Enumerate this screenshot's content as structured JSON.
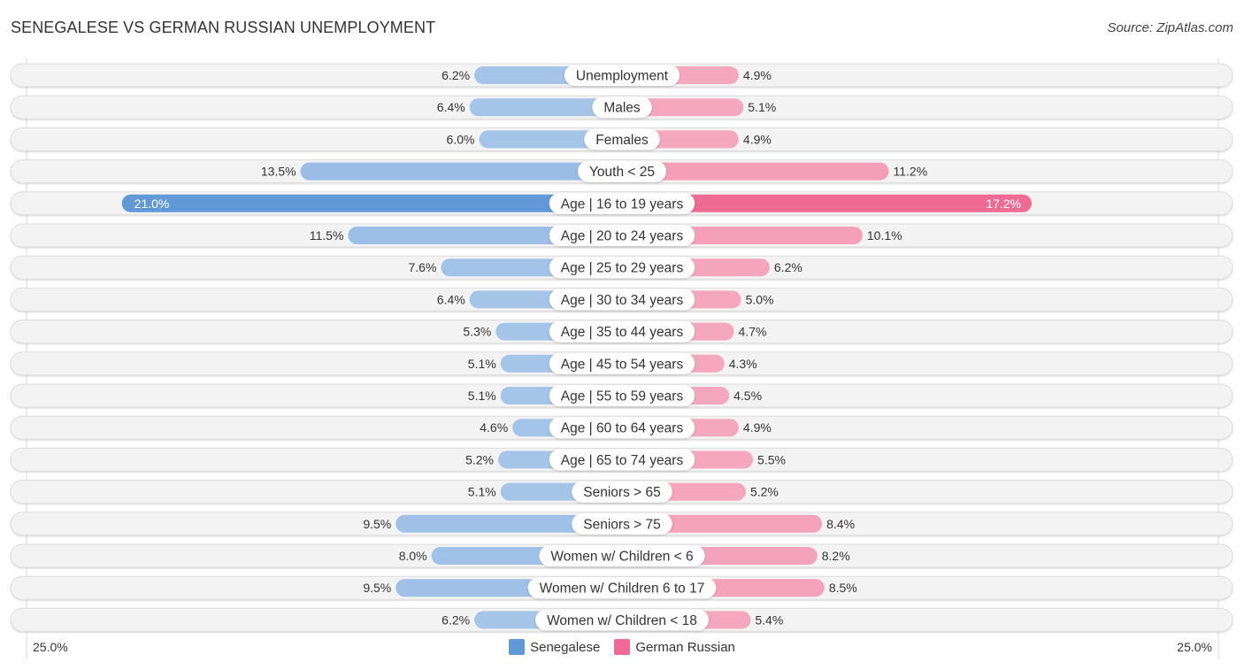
{
  "header": {
    "title": "SENEGALESE VS GERMAN RUSSIAN UNEMPLOYMENT",
    "source": "Source: ZipAtlas.com"
  },
  "colors": {
    "senegalese_light": "#a4c4e8",
    "senegalese_strong": "#6199d8",
    "german_russian_light": "#f5a7bf",
    "german_russian_strong": "#ef6b96",
    "row_bg": "#f3f3f3",
    "row_border": "#dddddd"
  },
  "chart_data": {
    "type": "bar",
    "orientation": "horizontal-diverging",
    "title": "SENEGALESE VS GERMAN RUSSIAN UNEMPLOYMENT",
    "xlim": [
      0,
      25.0
    ],
    "axis_min_label": "25.0%",
    "axis_max_label": "25.0%",
    "legend_position": "bottom-center",
    "categories": [
      "Unemployment",
      "Males",
      "Females",
      "Youth < 25",
      "Age | 16 to 19 years",
      "Age | 20 to 24 years",
      "Age | 25 to 29 years",
      "Age | 30 to 34 years",
      "Age | 35 to 44 years",
      "Age | 45 to 54 years",
      "Age | 55 to 59 years",
      "Age | 60 to 64 years",
      "Age | 65 to 74 years",
      "Seniors > 65",
      "Seniors > 75",
      "Women w/ Children < 6",
      "Women w/ Children 6 to 17",
      "Women w/ Children < 18"
    ],
    "series": [
      {
        "name": "Senegalese",
        "side": "left",
        "values": [
          6.2,
          6.4,
          6.0,
          13.5,
          21.0,
          11.5,
          7.6,
          6.4,
          5.3,
          5.1,
          5.1,
          4.6,
          5.2,
          5.1,
          9.5,
          8.0,
          9.5,
          6.2
        ],
        "labels": [
          "6.2%",
          "6.4%",
          "6.0%",
          "13.5%",
          "21.0%",
          "11.5%",
          "7.6%",
          "6.4%",
          "5.3%",
          "5.1%",
          "5.1%",
          "4.6%",
          "5.2%",
          "5.1%",
          "9.5%",
          "8.0%",
          "9.5%",
          "6.2%"
        ]
      },
      {
        "name": "German Russian",
        "side": "right",
        "values": [
          4.9,
          5.1,
          4.9,
          11.2,
          17.2,
          10.1,
          6.2,
          5.0,
          4.7,
          4.3,
          4.5,
          4.9,
          5.5,
          5.2,
          8.4,
          8.2,
          8.5,
          5.4
        ],
        "labels": [
          "4.9%",
          "5.1%",
          "4.9%",
          "11.2%",
          "17.2%",
          "10.1%",
          "6.2%",
          "5.0%",
          "4.7%",
          "4.3%",
          "4.5%",
          "4.9%",
          "5.5%",
          "5.2%",
          "8.4%",
          "8.2%",
          "8.5%",
          "5.4%"
        ]
      }
    ]
  },
  "legend": {
    "items": [
      {
        "label": "Senegalese"
      },
      {
        "label": "German Russian"
      }
    ]
  }
}
